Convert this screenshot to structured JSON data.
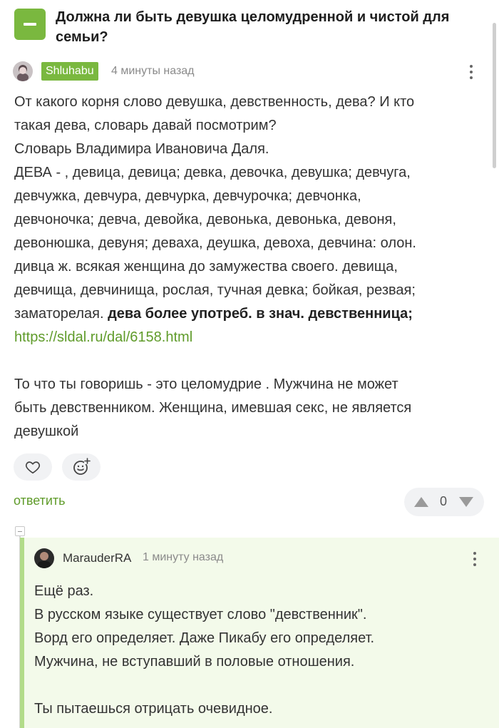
{
  "post": {
    "title": "Должна ли быть девушка целомудренной и чистой для семьи?"
  },
  "comment": {
    "author": "Shluhabu",
    "time": "4 минуты назад",
    "lines": [
      "От какого корня слово девушка, девственность, дева? И кто",
      "такая дева, словарь давай посмотрим?",
      "Словарь Владимира Ивановича Даля.",
      "ДЕВА - , девица, девица; девка, девочка, девушка; девчуга,",
      "девчужка, девчура, девчурка, девчурочка; девчонка,",
      "девчоночка; девча, девойка, девонька, девонька, девоня,",
      "девонюшка, девуня; деваха, деушка, девоха, девчина: олон.",
      "дивца ж. всякая женщина до замужества своего. девища,",
      "девчища, девчинища, рослая, тучная девка; бойкая, резвая;"
    ],
    "line10_plain": "заматорелая. ",
    "line10_bold": "дева более употреб. в знач. девственница;",
    "link": "https://sldal.ru/dal/6158.html",
    "para2": [
      "То что ты говоришь - это целомудрие . Мужчина не может",
      "быть девственником. Женщина, имевшая секс, не является",
      "девушкой"
    ],
    "reply_label": "ответить",
    "rating": "0"
  },
  "reply": {
    "author": "MarauderRA",
    "time": "1 минуту назад",
    "lines": [
      "Ещё раз.",
      "В русском языке существует слово \"девственник\".",
      "Ворд его определяет. Даже Пикабу его определяет.",
      "Мужчина, не вступавший в половые отношения."
    ],
    "last_line": "Ты пытаешься отрицать очевидное."
  },
  "colors": {
    "accent": "#7ab83f",
    "link": "#5f9b2a",
    "reply_bg": "#f3faea",
    "reply_border": "#b2dc89"
  },
  "icons": {
    "like": "heart-icon",
    "emoji": "smiley-add-icon",
    "upvote": "arrow-up-icon",
    "downvote": "arrow-down-icon",
    "more": "more-vertical-icon",
    "collapse": "minus-icon"
  }
}
